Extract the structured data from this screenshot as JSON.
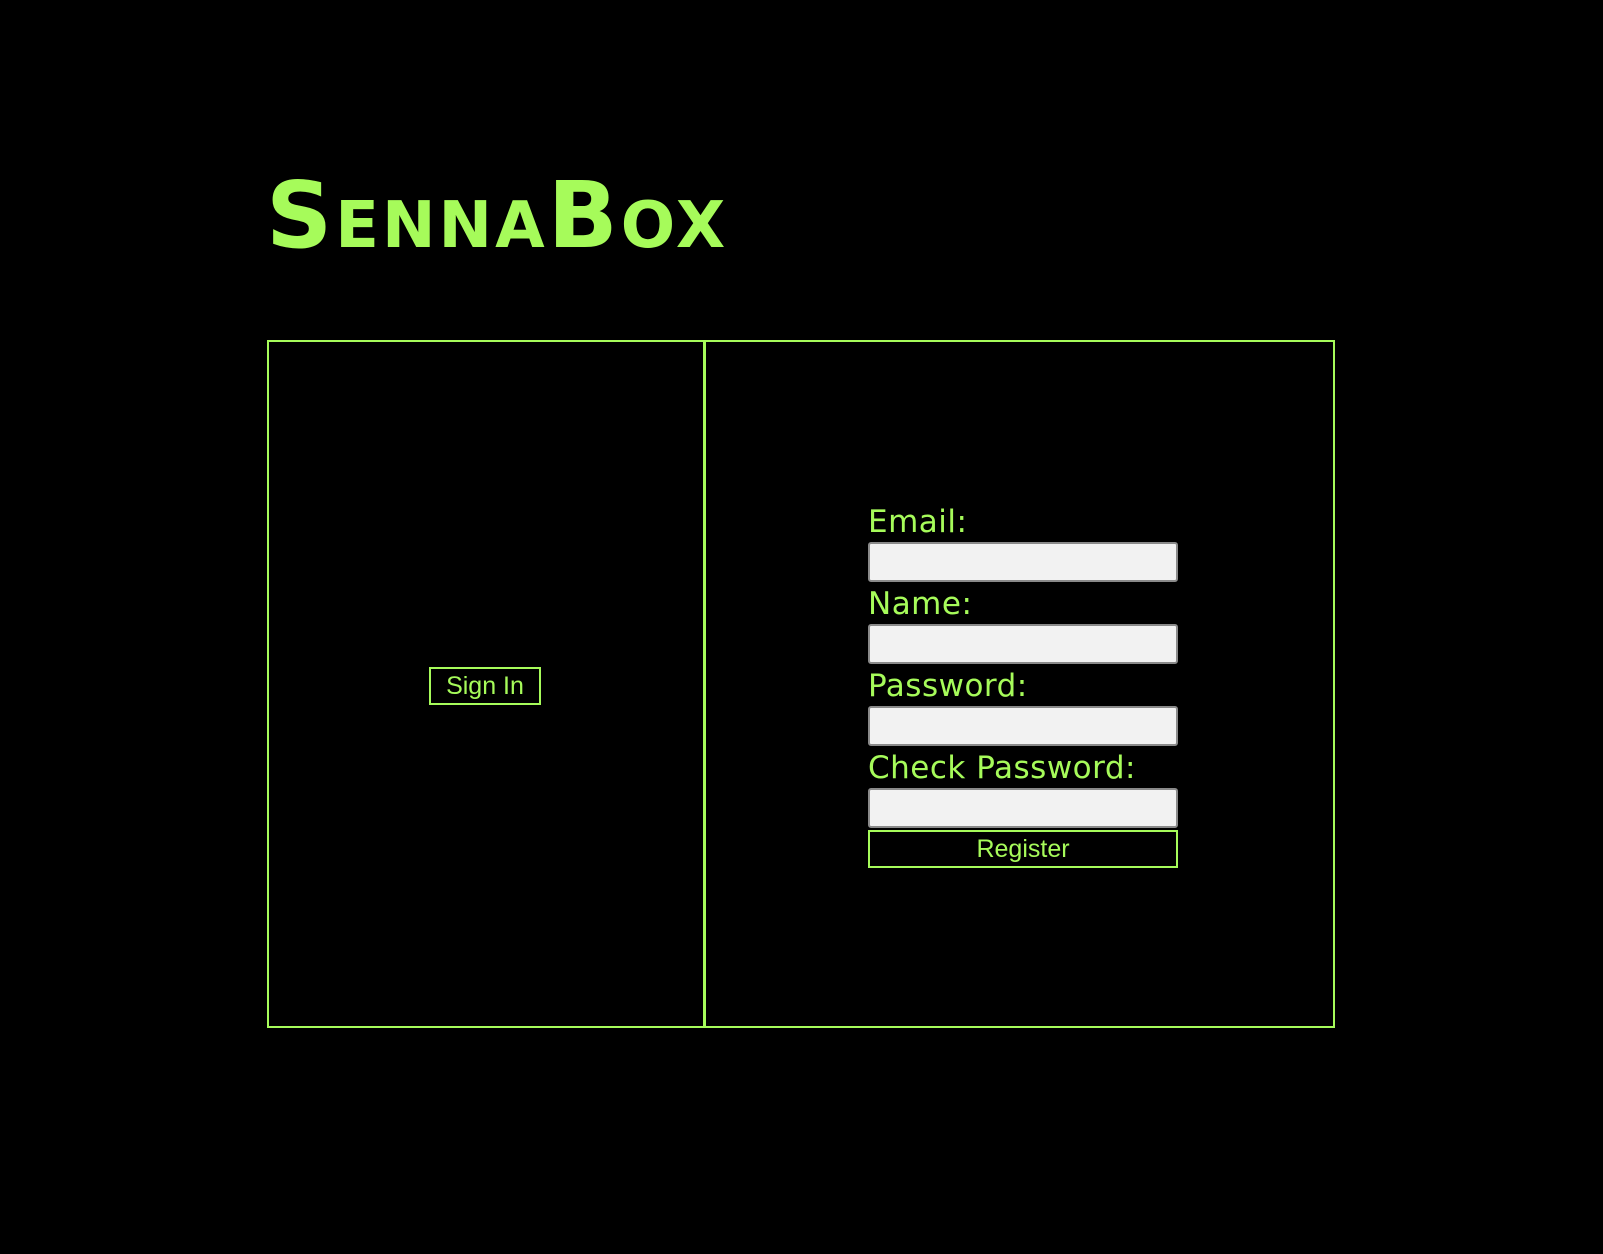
{
  "header": {
    "logo_first_cap": "S",
    "logo_first_rest": "ENNA",
    "logo_second_cap": "B",
    "logo_second_rest": "OX"
  },
  "signin": {
    "button_label": "Sign In"
  },
  "register": {
    "email_label": "Email:",
    "email_value": "",
    "name_label": "Name:",
    "name_value": "",
    "password_label": "Password:",
    "password_value": "",
    "check_password_label": "Check Password:",
    "check_password_value": "",
    "button_label": "Register"
  },
  "theme": {
    "accent": "#a6fb5a",
    "background": "#000000",
    "input_background": "#f2f2f2"
  }
}
